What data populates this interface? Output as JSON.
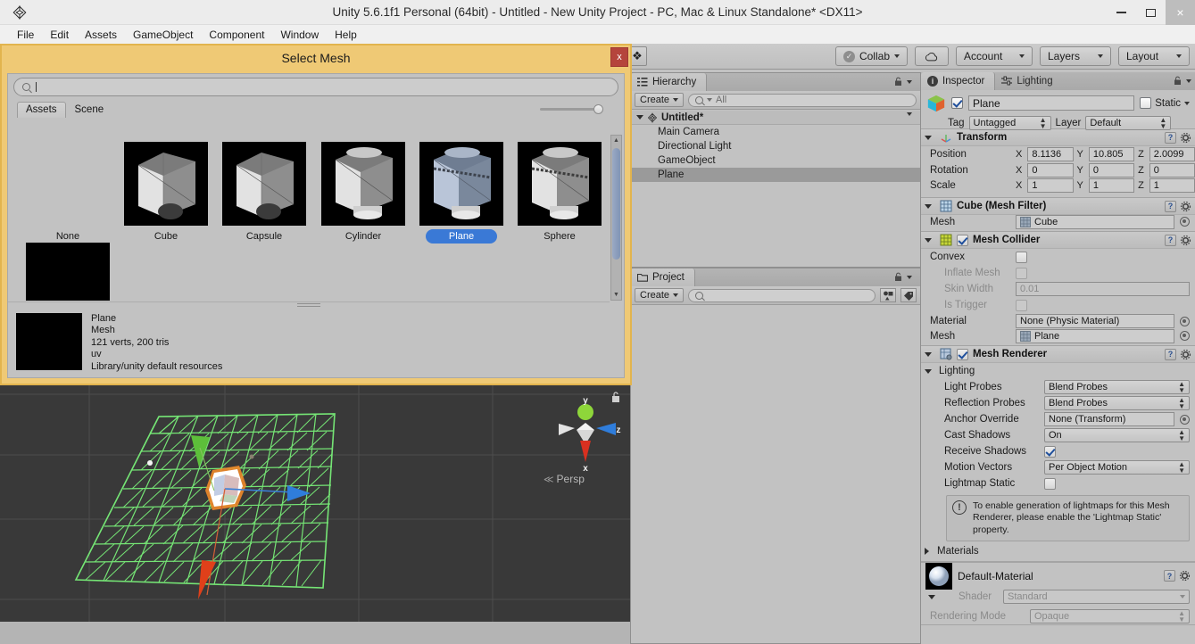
{
  "window": {
    "title": "Unity 5.6.1f1 Personal (64bit) - Untitled - New Unity Project - PC, Mac & Linux Standalone* <DX11>",
    "logo_icon": "unity-logo-icon",
    "minimize_icon": "minimize-icon",
    "maximize_icon": "maximize-icon",
    "close_icon": "close-icon",
    "close_label": "×"
  },
  "menubar": {
    "items": [
      "File",
      "Edit",
      "Assets",
      "GameObject",
      "Component",
      "Window",
      "Help"
    ]
  },
  "toolbar": {
    "hand_tool_icon": "hand-tool-icon",
    "hand_tool_label": "❖",
    "collab_label": "Collab",
    "collab_icon": "collab-check-icon",
    "cloud_icon": "cloud-icon",
    "account_label": "Account",
    "layers_label": "Layers",
    "layout_label": "Layout"
  },
  "hierarchy": {
    "tab_label": "Hierarchy",
    "tab_icon": "hierarchy-icon",
    "create_label": "Create",
    "search_placeholder": "All",
    "search_value": "",
    "lock_icon": "lock-icon",
    "menu_icon": "panel-menu-icon",
    "root": "Untitled*",
    "root_icon": "unity-scene-icon",
    "items": [
      {
        "label": "Main Camera",
        "selected": false
      },
      {
        "label": "Directional Light",
        "selected": false
      },
      {
        "label": "GameObject",
        "selected": false
      },
      {
        "label": "Plane",
        "selected": true
      }
    ]
  },
  "project": {
    "tab_label": "Project",
    "tab_icon": "folder-icon",
    "create_label": "Create",
    "search_value": "",
    "lock_icon": "lock-icon",
    "menu_icon": "panel-menu-icon",
    "filter_icon": "filter-by-type-icon",
    "label_icon": "filter-by-label-icon"
  },
  "inspector": {
    "tabs": [
      {
        "label": "Inspector",
        "icon": "info-icon",
        "active": true
      },
      {
        "label": "Lighting",
        "icon": "lighting-icon",
        "active": false
      }
    ],
    "lock_icon": "lock-icon",
    "object_icon": "gameobject-cube-icon",
    "enabled": true,
    "name_value": "Plane",
    "static_label": "Static",
    "static_checked": false,
    "tag_label": "Tag",
    "tag_value": "Untagged",
    "layer_label": "Layer",
    "layer_value": "Default",
    "transform": {
      "title": "Transform",
      "icon": "transform-axes-icon",
      "rows": [
        {
          "name": "Position",
          "x": "8.1136",
          "y": "10.805",
          "z": "2.0099"
        },
        {
          "name": "Rotation",
          "x": "0",
          "y": "0",
          "z": "0"
        },
        {
          "name": "Scale",
          "x": "1",
          "y": "1",
          "z": "1"
        }
      ],
      "axis_labels": [
        "X",
        "Y",
        "Z"
      ]
    },
    "mesh_filter": {
      "title": "Cube (Mesh Filter)",
      "icon": "mesh-filter-icon",
      "mesh_label": "Mesh",
      "mesh_value": "Cube"
    },
    "mesh_collider": {
      "title": "Mesh Collider",
      "icon": "mesh-collider-icon",
      "enabled": true,
      "convex_label": "Convex",
      "convex_checked": false,
      "inflate_label": "Inflate Mesh",
      "inflate_checked": false,
      "skin_width_label": "Skin Width",
      "skin_width_value": "0.01",
      "is_trigger_label": "Is Trigger",
      "is_trigger_checked": false,
      "material_label": "Material",
      "material_value": "None (Physic Material)",
      "mesh_label": "Mesh",
      "mesh_value": "Plane"
    },
    "mesh_renderer": {
      "title": "Mesh Renderer",
      "icon": "mesh-renderer-icon",
      "enabled": true,
      "lighting_label": "Lighting",
      "light_probes_label": "Light Probes",
      "light_probes_value": "Blend Probes",
      "reflection_probes_label": "Reflection Probes",
      "reflection_probes_value": "Blend Probes",
      "anchor_override_label": "Anchor Override",
      "anchor_override_value": "None (Transform)",
      "cast_shadows_label": "Cast Shadows",
      "cast_shadows_value": "On",
      "receive_shadows_label": "Receive Shadows",
      "receive_shadows_checked": true,
      "motion_vectors_label": "Motion Vectors",
      "motion_vectors_value": "Per Object Motion",
      "lightmap_static_label": "Lightmap Static",
      "lightmap_static_checked": false,
      "info_text": "To enable generation of lightmaps for this Mesh Renderer, please enable the 'Lightmap Static' property.",
      "info_icon": "warning-icon",
      "materials_label": "Materials"
    },
    "material": {
      "name": "Default-Material",
      "preview_icon": "material-sphere-preview",
      "shader_label": "Shader",
      "shader_value": "Standard",
      "rendering_mode_label": "Rendering Mode",
      "rendering_mode_value": "Opaque"
    },
    "help_icon": "help-book-icon",
    "gear_icon": "gear-icon"
  },
  "scene_view": {
    "gizmo": {
      "y_label": "y",
      "x_label": "x",
      "z_label": "z",
      "persp_label": "Persp",
      "lock_icon": "gizmo-lock-icon"
    }
  },
  "modal": {
    "title": "Select Mesh",
    "close_label": "x",
    "close_icon": "close-icon",
    "search_value": "",
    "search_icon": "search-icon",
    "tabs": [
      {
        "label": "Assets",
        "active": true
      },
      {
        "label": "Scene",
        "active": false
      }
    ],
    "items": [
      {
        "label": "None",
        "has_thumb": false,
        "selected": false
      },
      {
        "label": "Cube",
        "has_thumb": true,
        "selected": false
      },
      {
        "label": "Capsule",
        "has_thumb": true,
        "selected": false
      },
      {
        "label": "Cylinder",
        "has_thumb": true,
        "selected": false
      },
      {
        "label": "Plane",
        "has_thumb": true,
        "selected": true
      },
      {
        "label": "Sphere",
        "has_thumb": true,
        "selected": false
      }
    ],
    "detail": {
      "name": "Plane",
      "type": "Mesh",
      "stats": "121 verts, 200 tris",
      "uv": "uv",
      "path": "Library/unity default resources"
    },
    "scroll_up_icon": "scroll-up-arrow",
    "scroll_down_icon": "scroll-down-arrow"
  },
  "colors": {
    "modal_accent": "#efc975",
    "selection_blue": "#3a79d6",
    "close_red": "#b5453c",
    "panel_bg": "#c2c2c2",
    "scene_bg": "#393939",
    "mesh_wire_green": "#7ef07e"
  }
}
